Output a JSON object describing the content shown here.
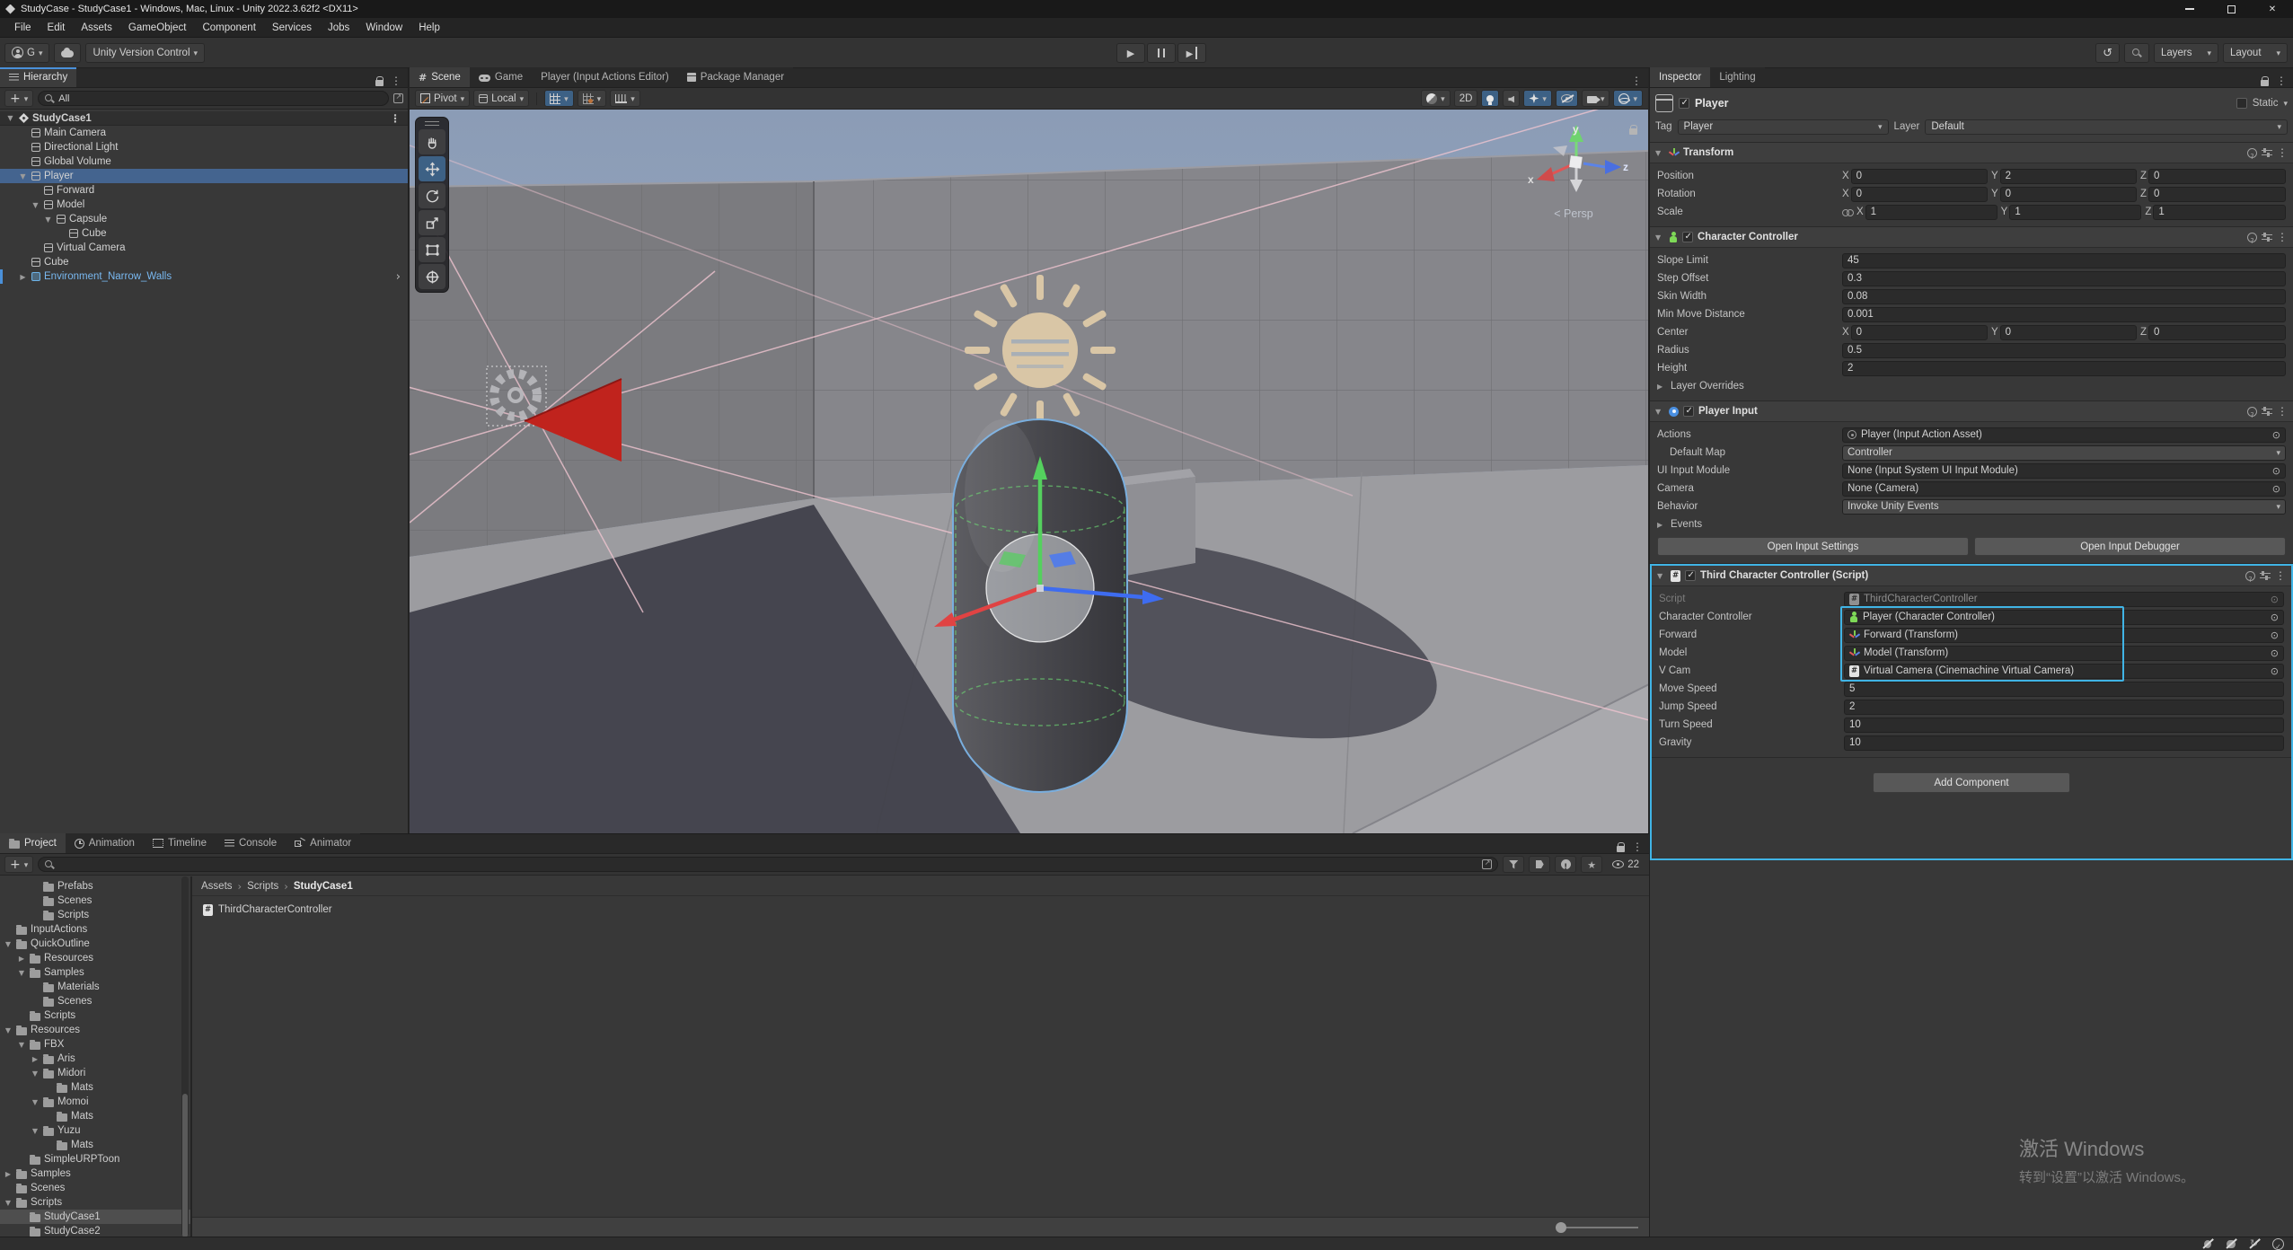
{
  "window": {
    "title": "StudyCase - StudyCase1 - Windows, Mac, Linux - Unity 2022.3.62f2 <DX11>"
  },
  "menu": {
    "items": [
      "File",
      "Edit",
      "Assets",
      "GameObject",
      "Component",
      "Services",
      "Jobs",
      "Window",
      "Help"
    ]
  },
  "toolbar": {
    "account_label": "G",
    "version_control_label": "Unity Version Control",
    "layers_label": "Layers",
    "layout_label": "Layout"
  },
  "hierarchy": {
    "tab_label": "Hierarchy",
    "search_value": "All",
    "items": [
      {
        "label": "StudyCase1",
        "depth": 0,
        "arrow": "open",
        "icon": "scene",
        "scene_header": true,
        "kebab": true
      },
      {
        "label": "Main Camera",
        "depth": 1,
        "icon": "cube"
      },
      {
        "label": "Directional Light",
        "depth": 1,
        "icon": "cube"
      },
      {
        "label": "Global Volume",
        "depth": 1,
        "icon": "cube"
      },
      {
        "label": "Player",
        "depth": 1,
        "arrow": "open",
        "icon": "cube",
        "selected": true
      },
      {
        "label": "Forward",
        "depth": 2,
        "icon": "cube"
      },
      {
        "label": "Model",
        "depth": 2,
        "arrow": "open",
        "icon": "cube"
      },
      {
        "label": "Capsule",
        "depth": 3,
        "arrow": "open",
        "icon": "cube"
      },
      {
        "label": "Cube",
        "depth": 4,
        "icon": "cube"
      },
      {
        "label": "Virtual Camera",
        "depth": 2,
        "icon": "cube"
      },
      {
        "label": "Cube",
        "depth": 1,
        "icon": "cube"
      },
      {
        "label": "Environment_Narrow_Walls",
        "depth": 1,
        "arrow": "closed",
        "icon": "prefab",
        "prefab": true,
        "chevron": true,
        "override_bar": true
      }
    ]
  },
  "scene_view": {
    "tabs": [
      {
        "label": "Scene",
        "icon": "grid",
        "active": true
      },
      {
        "label": "Game",
        "icon": "gamepad"
      },
      {
        "label": "Player (Input Actions Editor)",
        "icon": null
      },
      {
        "label": "Package Manager",
        "icon": "package"
      }
    ],
    "controls": {
      "pivot_label": "Pivot",
      "local_label": "Local",
      "two_d_label": "2D"
    },
    "gizmo": {
      "x": "x",
      "y": "y",
      "z": "z",
      "persp_label": "< Persp"
    }
  },
  "inspector": {
    "tabs": [
      {
        "label": "Inspector",
        "active": true
      },
      {
        "label": "Lighting"
      }
    ],
    "header": {
      "name": "Player",
      "static_label": "Static",
      "tag_label": "Tag",
      "tag_value": "Player",
      "layer_label": "Layer",
      "layer_value": "Default"
    },
    "axis_letters": [
      "X",
      "Y",
      "Z"
    ],
    "components": [
      {
        "title": "Transform",
        "icon": "axis",
        "checkbox": false,
        "rows": [
          {
            "label": "Position",
            "kind": "vec3",
            "values": [
              "0",
              "2",
              "0"
            ]
          },
          {
            "label": "Rotation",
            "kind": "vec3",
            "values": [
              "0",
              "0",
              "0"
            ]
          },
          {
            "label": "Scale",
            "kind": "vec3",
            "values": [
              "1",
              "1",
              "1"
            ],
            "link": true
          }
        ]
      },
      {
        "title": "Character Controller",
        "icon": "controller",
        "checkbox": true,
        "rows": [
          {
            "label": "Slope Limit",
            "kind": "text",
            "value": "45"
          },
          {
            "label": "Step Offset",
            "kind": "text",
            "value": "0.3"
          },
          {
            "label": "Skin Width",
            "kind": "text",
            "value": "0.08"
          },
          {
            "label": "Min Move Distance",
            "kind": "text",
            "value": "0.001"
          },
          {
            "label": "Center",
            "kind": "vec3",
            "values": [
              "0",
              "0",
              "0"
            ]
          },
          {
            "label": "Radius",
            "kind": "text",
            "value": "0.5"
          },
          {
            "label": "Height",
            "kind": "text",
            "value": "2"
          },
          {
            "label": "Layer Overrides",
            "kind": "foldout"
          }
        ]
      },
      {
        "title": "Player Input",
        "icon": "input",
        "checkbox": true,
        "rows": [
          {
            "label": "Actions",
            "kind": "object",
            "value": "Player (Input Action Asset)",
            "icon": "input-asset"
          },
          {
            "label": "Default Map",
            "kind": "dropdown",
            "value": "Controller",
            "indent": 1
          },
          {
            "label": "UI Input Module",
            "kind": "object",
            "value": "None (Input System UI Input Module)"
          },
          {
            "label": "Camera",
            "kind": "object",
            "value": "None (Camera)"
          },
          {
            "label": "Behavior",
            "kind": "dropdown",
            "value": "Invoke Unity Events"
          },
          {
            "label": "Events",
            "kind": "foldout"
          },
          {
            "kind": "buttons",
            "labels": [
              "Open Input Settings",
              "Open Input Debugger"
            ]
          }
        ]
      },
      {
        "title": "Third Character Controller (Script)",
        "icon": "script",
        "checkbox": true,
        "highlighted": true,
        "rows": [
          {
            "label": "Script",
            "kind": "object",
            "value": "ThirdCharacterController",
            "icon": "script",
            "disabled": true
          },
          {
            "label": "Character Controller",
            "kind": "object",
            "value": "Player (Character Controller)",
            "icon": "controller",
            "hl": true
          },
          {
            "label": "Forward",
            "kind": "object",
            "value": "Forward (Transform)",
            "icon": "axis",
            "hl": true
          },
          {
            "label": "Model",
            "kind": "object",
            "value": "Model (Transform)",
            "icon": "axis",
            "hl": true
          },
          {
            "label": "V Cam",
            "kind": "object",
            "value": "Virtual Camera (Cinemachine Virtual Camera)",
            "icon": "script",
            "hl": true
          },
          {
            "label": "Move Speed",
            "kind": "text",
            "value": "5"
          },
          {
            "label": "Jump Speed",
            "kind": "text",
            "value": "2"
          },
          {
            "label": "Turn Speed",
            "kind": "text",
            "value": "10"
          },
          {
            "label": "Gravity",
            "kind": "text",
            "value": "10"
          }
        ]
      }
    ],
    "add_component_label": "Add Component"
  },
  "project": {
    "tabs": [
      {
        "label": "Project",
        "icon": "folder",
        "active": true
      },
      {
        "label": "Animation",
        "icon": "clock"
      },
      {
        "label": "Timeline",
        "icon": "film"
      },
      {
        "label": "Console",
        "icon": "console-lines"
      },
      {
        "label": "Animator",
        "icon": "animator"
      }
    ],
    "search_value": "",
    "visibility_count": "22",
    "tree": [
      {
        "label": "Prefabs",
        "depth": 2,
        "icon": "folder"
      },
      {
        "label": "Scenes",
        "depth": 2,
        "icon": "folder"
      },
      {
        "label": "Scripts",
        "depth": 2,
        "icon": "folder"
      },
      {
        "label": "InputActions",
        "depth": 0,
        "icon": "folder"
      },
      {
        "label": "QuickOutline",
        "depth": 0,
        "arrow": "open",
        "icon": "folder"
      },
      {
        "label": "Resources",
        "depth": 1,
        "arrow": "closed",
        "icon": "folder"
      },
      {
        "label": "Samples",
        "depth": 1,
        "arrow": "open",
        "icon": "folder"
      },
      {
        "label": "Materials",
        "depth": 2,
        "icon": "folder"
      },
      {
        "label": "Scenes",
        "depth": 2,
        "icon": "folder"
      },
      {
        "label": "Scripts",
        "depth": 1,
        "icon": "folder"
      },
      {
        "label": "Resources",
        "depth": 0,
        "arrow": "open",
        "icon": "folder"
      },
      {
        "label": "FBX",
        "depth": 1,
        "arrow": "open",
        "icon": "folder"
      },
      {
        "label": "Aris",
        "depth": 2,
        "arrow": "closed",
        "icon": "folder"
      },
      {
        "label": "Midori",
        "depth": 2,
        "arrow": "open",
        "icon": "folder"
      },
      {
        "label": "Mats",
        "depth": 3,
        "icon": "folder"
      },
      {
        "label": "Momoi",
        "depth": 2,
        "arrow": "open",
        "icon": "folder"
      },
      {
        "label": "Mats",
        "depth": 3,
        "icon": "folder"
      },
      {
        "label": "Yuzu",
        "depth": 2,
        "arrow": "open",
        "icon": "folder"
      },
      {
        "label": "Mats",
        "depth": 3,
        "icon": "folder"
      },
      {
        "label": "SimpleURPToon",
        "depth": 1,
        "icon": "folder"
      },
      {
        "label": "Samples",
        "depth": 0,
        "arrow": "closed",
        "icon": "folder"
      },
      {
        "label": "Scenes",
        "depth": 0,
        "icon": "folder"
      },
      {
        "label": "Scripts",
        "depth": 0,
        "arrow": "open",
        "icon": "folder"
      },
      {
        "label": "StudyCase1",
        "depth": 1,
        "icon": "folder",
        "selected": true
      },
      {
        "label": "StudyCase2",
        "depth": 1,
        "icon": "folder"
      }
    ],
    "breadcrumb": [
      "Assets",
      "Scripts",
      "StudyCase1"
    ],
    "files": [
      {
        "name": "ThirdCharacterController",
        "icon": "script"
      }
    ]
  },
  "watermark": {
    "line1": "激活 Windows",
    "line2": "转到“设置”以激活 Windows。"
  },
  "colors": {
    "accent": "#40b4e5",
    "selection": "#44648f",
    "prefab_text": "#79b8f0"
  }
}
